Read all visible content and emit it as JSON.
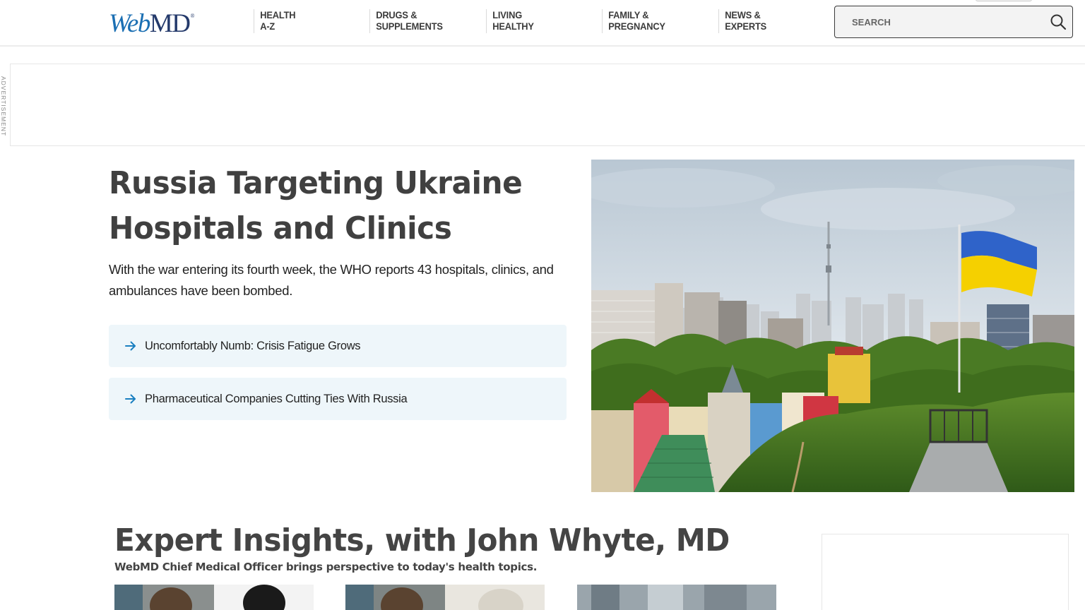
{
  "header": {
    "logo": {
      "part1": "Web",
      "part2": "MD",
      "reg": "®"
    },
    "nav": [
      {
        "line1": "HEALTH",
        "line2": "A-Z"
      },
      {
        "line1": "DRUGS &",
        "line2": "SUPPLEMENTS"
      },
      {
        "line1": "LIVING",
        "line2": "HEALTHY"
      },
      {
        "line1": "FAMILY &",
        "line2": "PREGNANCY"
      },
      {
        "line1": "NEWS &",
        "line2": "EXPERTS"
      }
    ],
    "search": {
      "placeholder": "SEARCH",
      "icon": "magnifier-icon"
    }
  },
  "ad": {
    "label": "ADVERTISEMENT"
  },
  "hero": {
    "title": "Russia Targeting Ukraine Hospitals and Clinics",
    "description": "With the war entering its fourth week, the WHO reports 43 hospitals, clinics, and ambulances have been bombed.",
    "related": [
      {
        "text": "Uncomfortably Numb: Crisis Fatigue Grows",
        "icon": "arrow-right-icon"
      },
      {
        "text": "Pharmaceutical Companies Cutting Ties With Russia",
        "icon": "arrow-right-icon"
      }
    ],
    "image": {
      "flag_colors": [
        "#2f63c9",
        "#f5d000"
      ],
      "sky_color": "#cfd9e2"
    }
  },
  "insights": {
    "title": "Expert Insights, with John Whyte, MD",
    "subtitle": "WebMD Chief Medical Officer brings perspective to today's health topics."
  },
  "colors": {
    "logo_web": "#1b6fb3",
    "logo_md": "#243a6b",
    "accent_arrow": "#1a7fc0",
    "related_bg": "#eef6fa",
    "heading": "#404040"
  }
}
